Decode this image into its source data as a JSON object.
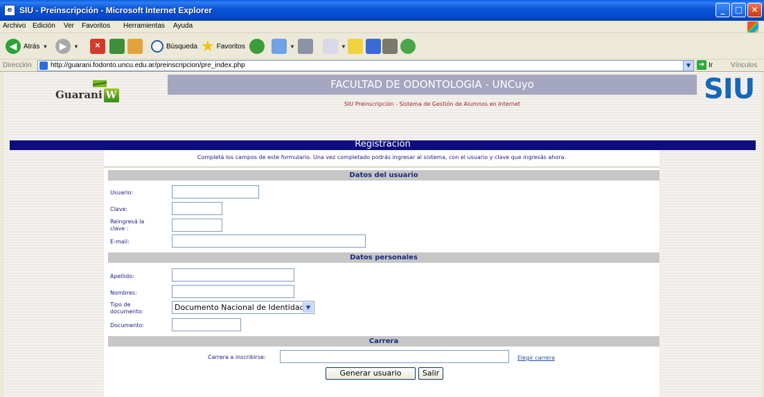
{
  "window": {
    "title": "SIU - Preinscripción - Microsoft Internet Explorer",
    "controls": {
      "minimize": "_",
      "maximize": "□",
      "close": "✕"
    }
  },
  "menu": [
    "Archivo",
    "Edición",
    "Ver",
    "Favoritos",
    "Herramientas",
    "Ayuda"
  ],
  "toolbar": {
    "back_label": "Atrás",
    "search_label": "Búsqueda",
    "favorites_label": "Favoritos"
  },
  "address": {
    "label": "Dirección",
    "url": "http://guarani.fodonto.uncu.edu.ar/preinscripcion/pre_index.php",
    "go_label": "Ir",
    "links_label": "Vínculos"
  },
  "page": {
    "logo_left": "Guarani",
    "logo_right": "SIU",
    "faculty": "FACULTAD DE ODONTOLOGIA - UNCuyo",
    "subtitle": "SIU Preinscripción - Sistema de Gestión de Alumnos en Internet",
    "section_title": "Registración",
    "intro": "Completá los campos de este formulario. Una vez completado podrás ingresar al sistema, con el usuario y clave que ingresás ahora."
  },
  "form": {
    "user_group": "Datos del usuario",
    "usuario_label": "Usuario:",
    "clave_label": "Clave:",
    "reclave_label_1": "Reingresá la",
    "reclave_label_2": "clave :",
    "email_label": "E-mail:",
    "personal_group": "Datos personales",
    "apellido_label": "Apellido:",
    "nombres_label": "Nombres:",
    "tipo_doc_label_1": "Tipo de",
    "tipo_doc_label_2": "documento:",
    "tipo_doc_value": "Documento Nacional de Identidad",
    "documento_label": "Documento:",
    "career_group": "Carrera",
    "carrera_label": "Carrera a inscribirse:",
    "elegir_carrera": "Elegir carrera",
    "generar_button": "Generar usuario",
    "salir_button": "Salir"
  },
  "colors": {
    "titlebar": "#0046c8",
    "header_band": "#a5a6bf",
    "section_bar": "#0d0d7f",
    "group_bar": "#c6c6c6",
    "subtitle_red": "#9a1e1e",
    "siu_blue": "#1468b8"
  }
}
